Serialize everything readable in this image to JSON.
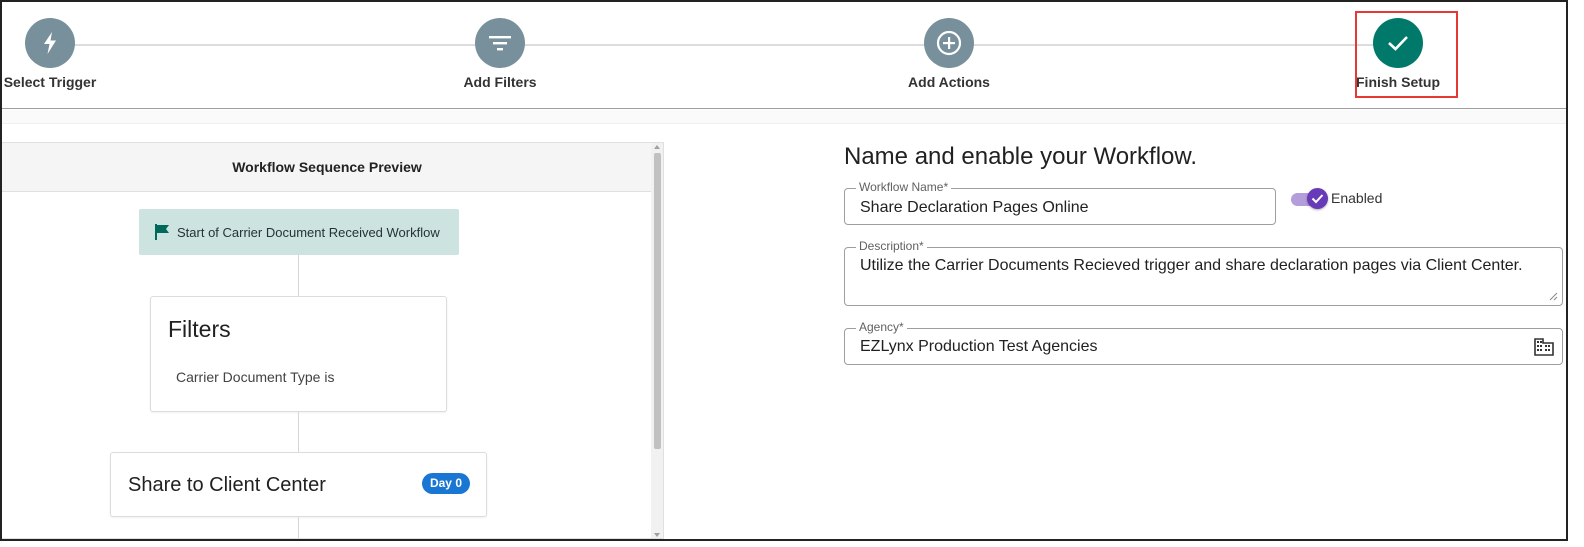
{
  "stepper": {
    "steps": [
      {
        "label": "Select Trigger",
        "icon": "lightning-icon",
        "status": "pending"
      },
      {
        "label": "Add Filters",
        "icon": "filter-icon",
        "status": "pending"
      },
      {
        "label": "Add Actions",
        "icon": "plus-circle-icon",
        "status": "pending"
      },
      {
        "label": "Finish Setup",
        "icon": "check-icon",
        "status": "active"
      }
    ]
  },
  "preview": {
    "header": "Workflow Sequence Preview",
    "start_node": "Start of Carrier Document Received Workflow",
    "filters_card": {
      "title": "Filters",
      "condition": "Carrier Document Type is"
    },
    "action_card": {
      "title": "Share to Client Center",
      "badge": "Day 0"
    }
  },
  "form": {
    "heading": "Name and enable your Workflow.",
    "workflow_name": {
      "label": "Workflow Name*",
      "value": "Share Declaration Pages Online"
    },
    "enabled_toggle": {
      "label": "Enabled",
      "checked": true
    },
    "description": {
      "label": "Description*",
      "value": "Utilize the Carrier Documents Recieved trigger and share declaration pages via Client Center."
    },
    "agency": {
      "label": "Agency*",
      "value": "EZLynx Production Test Agencies"
    }
  },
  "colors": {
    "step_inactive": "#78909c",
    "step_active": "#00796b",
    "highlight": "#e53935",
    "start_node_bg": "#cce3df",
    "badge": "#1976d2",
    "toggle": "#673ab7"
  }
}
